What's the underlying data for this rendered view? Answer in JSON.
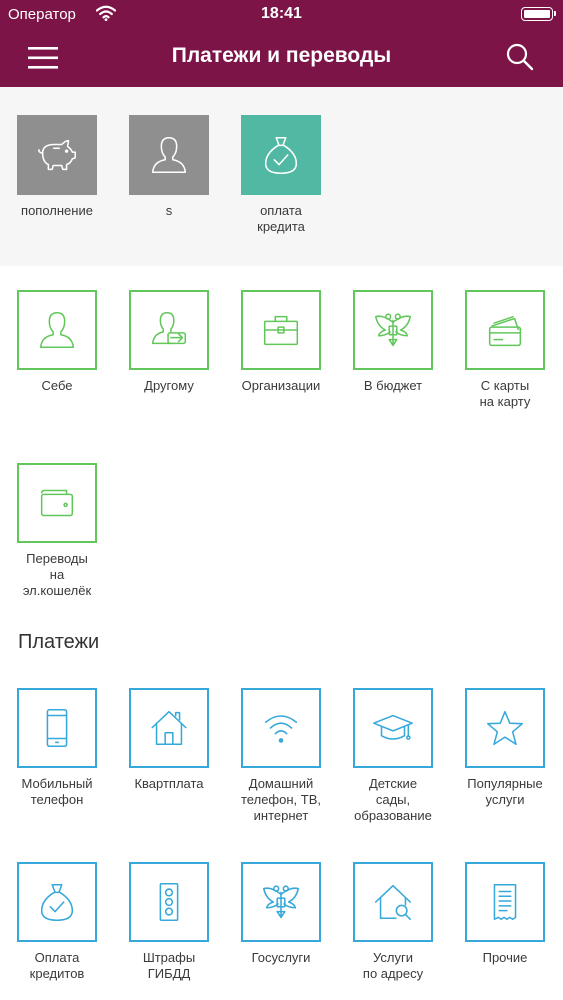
{
  "status": {
    "carrier": "Оператор",
    "time": "18:41"
  },
  "nav": {
    "title": "Платежи и переводы"
  },
  "recent": [
    {
      "label": "пополнение",
      "icon": "piggy-bank-icon"
    },
    {
      "label": "s",
      "icon": "person-icon"
    },
    {
      "label": "оплата\nкредита",
      "icon": "money-bag-check-icon"
    }
  ],
  "transfers": [
    {
      "label": "Себе",
      "icon": "person-icon"
    },
    {
      "label": "Другому",
      "icon": "person-arrow-icon"
    },
    {
      "label": "Организации",
      "icon": "briefcase-icon"
    },
    {
      "label": "В бюджет",
      "icon": "eagle-emblem-icon"
    },
    {
      "label": "С карты\nна карту",
      "icon": "cards-icon"
    },
    {
      "label": "Переводы\nна\nэл.кошелёк",
      "icon": "wallet-icon"
    }
  ],
  "payments_section": {
    "title": "Платежи"
  },
  "payments": [
    {
      "label": "Мобильный\nтелефон",
      "icon": "mobile-phone-icon"
    },
    {
      "label": "Квартплата",
      "icon": "house-icon"
    },
    {
      "label": "Домашний\nтелефон, ТВ,\nинтернет",
      "icon": "wifi-icon"
    },
    {
      "label": "Детские\nсады,\nобразование",
      "icon": "graduation-cap-icon"
    },
    {
      "label": "Популярные\nуслуги",
      "icon": "star-icon"
    },
    {
      "label": "Оплата\nкредитов",
      "icon": "money-bag-check-icon"
    },
    {
      "label": "Штрафы\nГИБДД",
      "icon": "traffic-light-icon"
    },
    {
      "label": "Госуслуги",
      "icon": "eagle-emblem-icon"
    },
    {
      "label": "Услуги\nпо адресу",
      "icon": "house-search-icon"
    },
    {
      "label": "Прочие",
      "icon": "receipt-icon"
    }
  ],
  "colors": {
    "header": "#7d1448",
    "transfer_border": "#62c75b",
    "payment_border": "#36a8d9",
    "recent_grey": "#8f8f8f",
    "recent_teal": "#51b9a3"
  }
}
